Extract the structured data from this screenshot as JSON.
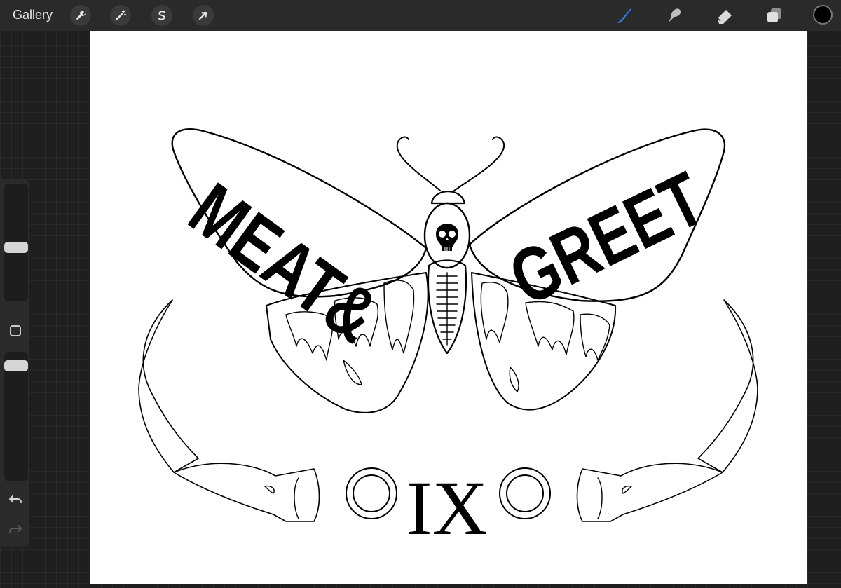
{
  "toolbar": {
    "gallery_label": "Gallery",
    "left_tools": [
      {
        "name": "actions",
        "icon": "wrench-icon"
      },
      {
        "name": "adjustments",
        "icon": "magic-wand-icon"
      },
      {
        "name": "selection",
        "icon": "selection-s-icon"
      },
      {
        "name": "transform",
        "icon": "arrow-cursor-icon"
      }
    ],
    "right_tools": [
      {
        "name": "brush",
        "icon": "brush-icon",
        "active": true
      },
      {
        "name": "smudge",
        "icon": "smudge-finger-icon"
      },
      {
        "name": "eraser",
        "icon": "eraser-icon"
      },
      {
        "name": "layers",
        "icon": "layers-icon"
      }
    ],
    "active_color": "#000000",
    "accent_color": "#2f7cf6"
  },
  "sidebar": {
    "brush_size_level": 0.45,
    "opacity_level": 0.95,
    "modifier_icon": "square-modifier-icon",
    "undo_icon": "undo-icon",
    "redo_icon": "redo-icon"
  },
  "artwork": {
    "left_wing_text": "MEAT&",
    "right_wing_text": "GREET",
    "numeral": "IX"
  }
}
